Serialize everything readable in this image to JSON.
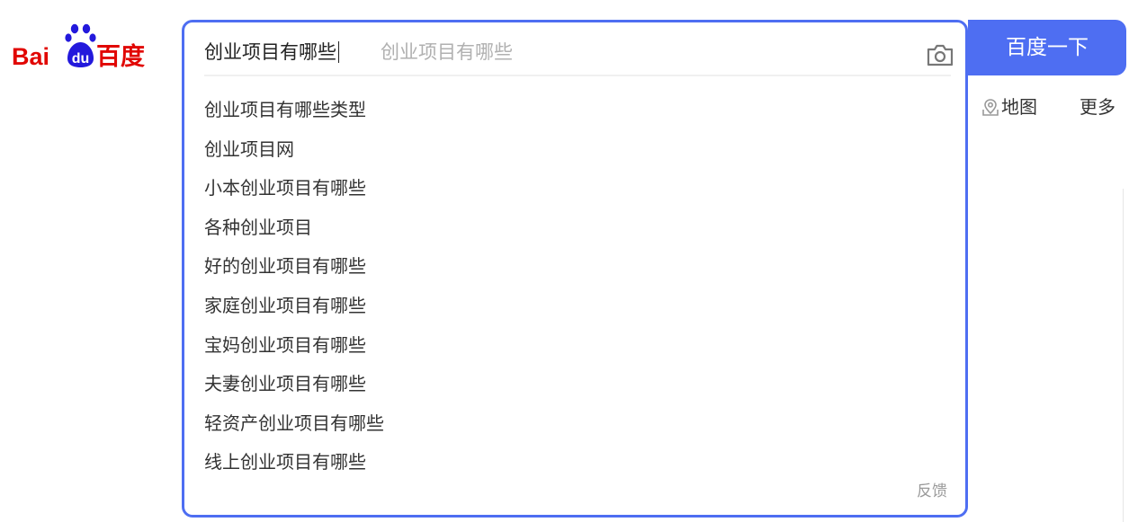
{
  "logo": {
    "text_part1": "Bai",
    "text_part2": "du",
    "text_part3": "百度",
    "color_red": "#e10602",
    "color_blue": "#2319dc"
  },
  "search": {
    "query": "创业项目有哪些",
    "hint": "创业项目有哪些",
    "camera_icon": "camera-icon",
    "button_label": "百度一下",
    "accent": "#4e6ef2"
  },
  "suggestions": [
    "创业项目有哪些类型",
    "创业项目网",
    "小本创业项目有哪些",
    "各种创业项目",
    "好的创业项目有哪些",
    "家庭创业项目有哪些",
    "宝妈创业项目有哪些",
    "夫妻创业项目有哪些",
    "轻资产创业项目有哪些",
    "线上创业项目有哪些"
  ],
  "feedback_label": "反馈",
  "side_links": {
    "map_label": "地图",
    "more_label": "更多"
  }
}
